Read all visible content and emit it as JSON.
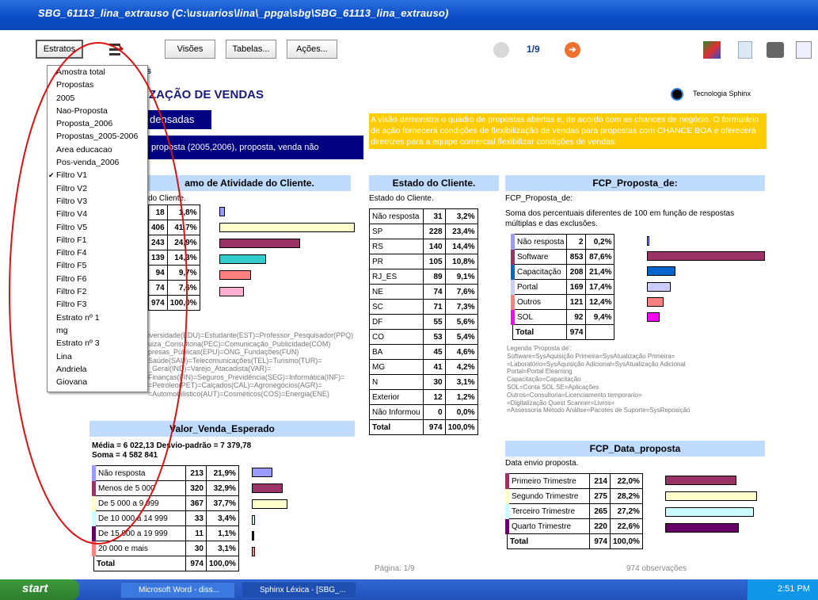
{
  "window": {
    "title": "SBG_61113_lina_extrauso (C:\\usuarios\\lina\\_ppga\\sbg\\SBG_61113_lina_extrauso)"
  },
  "toolbar": {
    "estratos": "Estratos",
    "visoes": "Visões",
    "tabelas": "Tabelas...",
    "acoes": "Ações...",
    "page": "1/9"
  },
  "header": {
    "title": "ZAÇÃO DE VENDAS",
    "subtitle": "densadas",
    "desc": "proposta (2005,2006), proposta, venda não",
    "brand": "Tecnologia Sphinx",
    "title_fragment": "s"
  },
  "info_text": "A visão demonstra o quadro de propostas abertas e, de acordo com as chances de negócio. O formulário de ação fornecerá condições de flexibilização de vendas para propostas com CHANCE BOA e oferecerá diretrizes para a equipe comercial flexibilizar condições de vendas.",
  "menu": {
    "items": [
      "Amostra total",
      "Propostas",
      "2005",
      "Nao-Proposta",
      "Proposta_2006",
      "Propostas_2005-2006",
      "Area educacao",
      "Pos-venda_2006",
      "Filtro V1",
      "Filtro V2",
      "Filtro V3",
      "Filtro V4",
      "Filtro V5",
      "Filtro F1",
      "Filtro F4",
      "Filtro F5",
      "Filtro F6",
      "Filtro F2",
      "Filtro F3",
      "Estrato nº 1",
      "mg",
      "Estrato nº 3",
      "Lina",
      "Andriela",
      "Giovana"
    ],
    "checked_index": 8
  },
  "ramo": {
    "title": "amo de Atividade do Cliente.",
    "sub": "do Cliente.",
    "rows": [
      [
        "18",
        "1,8%"
      ],
      [
        "406",
        "41,7%"
      ],
      [
        "243",
        "24,9%"
      ],
      [
        "139",
        "14,3%"
      ],
      [
        "94",
        "9,7%"
      ],
      [
        "74",
        "7,6%"
      ],
      [
        "974",
        "100,0%"
      ]
    ],
    "pct": [
      1.8,
      41.7,
      24.9,
      14.3,
      9.7,
      7.6
    ],
    "colors": [
      "#9999ff",
      "#ffffcc",
      "#993366",
      "#33cccc",
      "#ff8080",
      "#ffb0d0"
    ],
    "legend": [
      "iversidade(EDU)=Estudante(EST)=Professor_Pesquisador(PPQ)",
      "uiza_Consultoria(PEC)=Comunicação_Publicidade(COM)",
      "presas_Públicas(EPU)=ONG_Fundações(FUN)",
      "Saúde(SAU)=Telecomunicações(TEL)=Turismo(TUR)=",
      "_Geral(IND)=Varejo_Atacadista(VAR)=",
      "Finanças(FIN)=Seguros_Previdência(SEG)=Informática(INF)=",
      "=Petróleo(PET)=Calçados(CAL)=Agronegócios(AGR)=",
      "=Automobilístico(AUT)=Cosméticos(COS)=Energia(ENE)"
    ]
  },
  "valor": {
    "title": "Valor_Venda_Esperado",
    "stats1": "Média = 6 022,13   Desvio-padrão = 7 379,78",
    "stats2": "Soma = 4 582 841",
    "rows": [
      [
        "Não resposta",
        "213",
        "21,9%"
      ],
      [
        "Menos de 5 000",
        "320",
        "32,9%"
      ],
      [
        "De 5 000 a 9 999",
        "367",
        "37,7%"
      ],
      [
        "De 10 000 a 14 999",
        "33",
        "3,4%"
      ],
      [
        "De 15 000 a 19 999",
        "11",
        "1,1%"
      ],
      [
        "20 000 e mais",
        "30",
        "3,1%"
      ],
      [
        "Total",
        "974",
        "100,0%"
      ]
    ],
    "pct": [
      21.9,
      32.9,
      37.7,
      3.4,
      1.1,
      3.1
    ],
    "colors": [
      "#9999ff",
      "#993366",
      "#ffffcc",
      "#ccffff",
      "#660066",
      "#ff8080"
    ]
  },
  "estado": {
    "title": "Estado do Cliente.",
    "sub": "Estado do Cliente.",
    "rows": [
      [
        "Não resposta",
        "31",
        "3,2%"
      ],
      [
        "SP",
        "228",
        "23,4%"
      ],
      [
        "RS",
        "140",
        "14,4%"
      ],
      [
        "PR",
        "105",
        "10,8%"
      ],
      [
        "RJ_ES",
        "89",
        "9,1%"
      ],
      [
        "NE",
        "74",
        "7,6%"
      ],
      [
        "SC",
        "71",
        "7,3%"
      ],
      [
        "DF",
        "55",
        "5,6%"
      ],
      [
        "CO",
        "53",
        "5,4%"
      ],
      [
        "BA",
        "45",
        "4,6%"
      ],
      [
        "MG",
        "41",
        "4,2%"
      ],
      [
        "N",
        "30",
        "3,1%"
      ],
      [
        "Exterior",
        "12",
        "1,2%"
      ],
      [
        "Não Informou",
        "0",
        "0,0%"
      ],
      [
        "Total",
        "974",
        "100,0%"
      ]
    ]
  },
  "fcp": {
    "title": "FCP_Proposta_de:",
    "sub": "FCP_Proposta_de:",
    "note": "Soma dos percentuais diferentes de 100 em função de respostas múltiplas e das exclusões.",
    "rows": [
      [
        "Não resposta",
        "2",
        "0,2%"
      ],
      [
        "Software",
        "853",
        "87,6%"
      ],
      [
        "Capacitação",
        "208",
        "21,4%"
      ],
      [
        "Portal",
        "169",
        "17,4%"
      ],
      [
        "Outros",
        "121",
        "12,4%"
      ],
      [
        "SOL",
        "92",
        "9,4%"
      ],
      [
        "Total",
        "974",
        ""
      ]
    ],
    "pct": [
      0.2,
      87.6,
      21.4,
      17.4,
      12.4,
      9.4
    ],
    "colors": [
      "#9999ff",
      "#993366",
      "#0066cc",
      "#ccccff",
      "#ff8080",
      "#ff00ff"
    ],
    "legend": [
      "Legenda 'Proposta de':",
      "Software=SysAquisição Primeira=SysAtualização Primeira=",
      "=Laboratório=SysAquisição Adicional=SysAtualização Adicional",
      "Portal=Portal Elearning",
      "Capacitação=Capacitação",
      "SOL=Conta SOL SE=Aplicações",
      "Outros=Consultoria=Licenciamento temporario=",
      "=Digitalização Quest Scanner=Livros=",
      "=Assessoria Método Análise=Pacotes de Suporte=SysReposição"
    ]
  },
  "data_proposta": {
    "title": "FCP_Data_proposta",
    "sub": "Data envio proposta.",
    "rows": [
      [
        "Primeiro Trimestre",
        "214",
        "22,0%"
      ],
      [
        "Segundo Trimestre",
        "275",
        "28,2%"
      ],
      [
        "Terceiro Trimestre",
        "265",
        "27,2%"
      ],
      [
        "Quarto Trimestre",
        "220",
        "22,6%"
      ],
      [
        "Total",
        "974",
        "100,0%"
      ]
    ],
    "pct": [
      22.0,
      28.2,
      27.2,
      22.6
    ],
    "colors": [
      "#993366",
      "#ffffcc",
      "#ccffff",
      "#660066"
    ]
  },
  "footer": {
    "page": "Página: 1/9",
    "obs": "974 observações"
  },
  "taskbar": {
    "start": "start",
    "task1": "Microsoft Word - diss...",
    "task2": "Sphinx Léxica - [SBG_...",
    "time": "2:51 PM"
  }
}
